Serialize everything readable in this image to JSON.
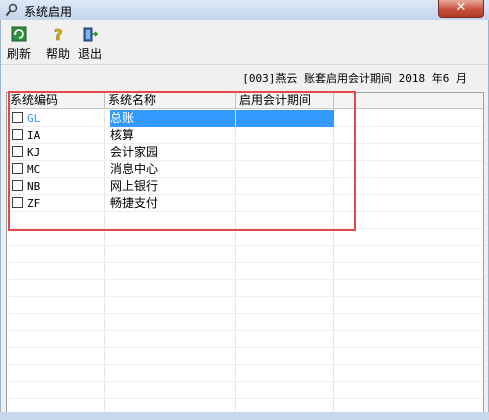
{
  "window": {
    "title": "系统启用",
    "close_glyph": "✕"
  },
  "toolbar": [
    {
      "label": "刷新",
      "icon": "refresh-icon"
    },
    {
      "label": "帮助",
      "icon": "help-icon"
    },
    {
      "label": "退出",
      "icon": "exit-icon"
    }
  ],
  "info_line": "[003]燕云 账套启用会计期间 2018 年6 月",
  "table": {
    "columns": [
      "系统编码",
      "系统名称",
      "启用会计期间"
    ],
    "rows": [
      {
        "code": "GL",
        "name": "总账",
        "period": "",
        "checked": false,
        "selected": true
      },
      {
        "code": "IA",
        "name": "核算",
        "period": "",
        "checked": false,
        "selected": false
      },
      {
        "code": "KJ",
        "name": "会计家园",
        "period": "",
        "checked": false,
        "selected": false
      },
      {
        "code": "MC",
        "name": "消息中心",
        "period": "",
        "checked": false,
        "selected": false
      },
      {
        "code": "NB",
        "name": "网上银行",
        "period": "",
        "checked": false,
        "selected": false
      },
      {
        "code": "ZF",
        "name": "畅捷支付",
        "period": "",
        "checked": false,
        "selected": false
      }
    ]
  },
  "colors": {
    "selection": "#3399ff",
    "annotation_border": "#e04a4a",
    "close_button": "#c7513d"
  }
}
